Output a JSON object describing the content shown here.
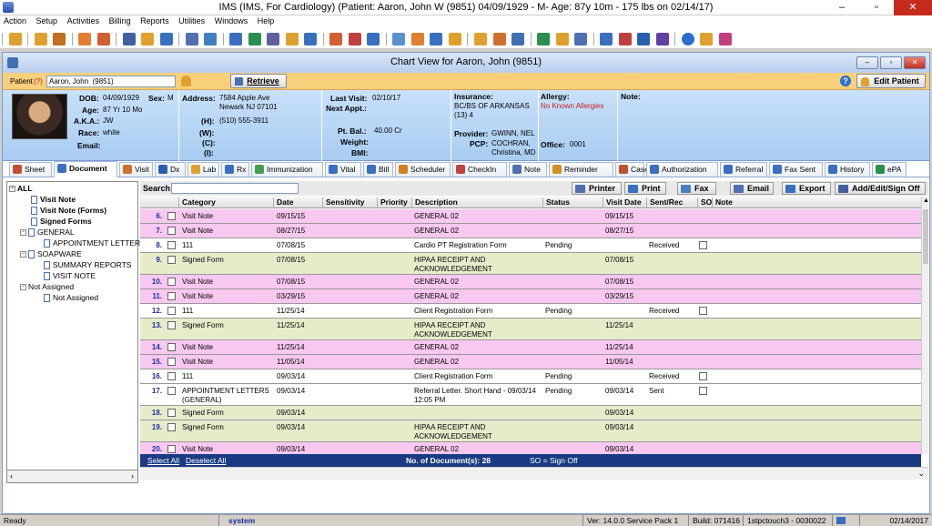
{
  "window": {
    "title": "IMS (IMS, For Cardiology)     (Patient: Aaron, John W (9851) 04/09/1929 - M- Age: 87y 10m  - 175 lbs on 02/14/17)",
    "min": "–",
    "max": "▫",
    "close": "✕"
  },
  "menu": [
    "Action",
    "Setup",
    "Activities",
    "Billing",
    "Reports",
    "Utilities",
    "Windows",
    "Help"
  ],
  "chart_window": {
    "title": "Chart View for Aaron, John  (9851)"
  },
  "patient_bar": {
    "label": "Patient",
    "q": "(?)",
    "value": "Aaron, John  (9851)",
    "retrieve": "Retrieve",
    "edit_patient": "Edit Patient",
    "help": "?"
  },
  "info": {
    "dob_label": "DOB:",
    "dob": "04/09/1929",
    "sex_label": "Sex:",
    "sex": "M",
    "age_label": "Age:",
    "age": "87 Yr 10 Mo",
    "aka_label": "A.K.A.:",
    "aka": "JW",
    "race_label": "Race:",
    "race": "white",
    "email_label": "Email:",
    "address_label": "Address:",
    "address1": "7584 Apple Ave",
    "address2": "Newark  NJ  07101",
    "h_label": "(H):",
    "h": "(510) 555-3911",
    "w_label": "(W):",
    "c_label": "(C):",
    "i_label": "(I):",
    "last_visit_label": "Last Visit:",
    "last_visit": "02/10/17",
    "next_appt_label": "Next Appt.:",
    "pt_bal_label": "Pt. Bal.:",
    "pt_bal": "40.00 Cr",
    "weight_label": "Weight:",
    "bmi_label": "BMI:",
    "insurance_label": "Insurance:",
    "insurance1": "BC/BS OF ARKANSAS",
    "insurance2": "(13)    4",
    "provider_label": "Provider:",
    "provider": "GWINN, NEL",
    "pcp_label": "PCP:",
    "pcp1": "COCHRAN,",
    "pcp2": "Christina, MD",
    "allergy_label": "Allergy:",
    "allergy": "No Known Allergies",
    "office_label": "Office:",
    "office": "0001",
    "note_label": "Note:"
  },
  "tabs": [
    {
      "label": "Sheet",
      "icon": "sheet-icon",
      "color": "#c05030"
    },
    {
      "label": "Document",
      "icon": "document-icon",
      "color": "#3a6fc0"
    },
    {
      "label": "Visit",
      "icon": "visit-icon",
      "color": "#d07030"
    },
    {
      "label": "Dx",
      "icon": "dx-icon",
      "color": "#2a5fb0"
    },
    {
      "label": "Lab",
      "icon": "lab-icon",
      "color": "#e0a030"
    },
    {
      "label": "Rx",
      "icon": "rx-icon",
      "color": "#3a6fc0"
    },
    {
      "label": "Immunization",
      "icon": "immunization-icon",
      "color": "#40a050"
    },
    {
      "label": "Vital",
      "icon": "vital-icon",
      "color": "#3a6fc0"
    },
    {
      "label": "Bill",
      "icon": "bill-icon",
      "color": "#3a6fc0"
    },
    {
      "label": "Scheduler",
      "icon": "scheduler-icon",
      "color": "#d08020"
    },
    {
      "label": "CheckIn",
      "icon": "checkin-icon",
      "color": "#c04040"
    },
    {
      "label": "Note",
      "icon": "note-icon",
      "color": "#5070b0"
    },
    {
      "label": "Reminder",
      "icon": "reminder-icon",
      "color": "#d09020"
    },
    {
      "label": "Case",
      "icon": "case-icon",
      "color": "#c05030"
    },
    {
      "label": "Authorization",
      "icon": "authorization-icon",
      "color": "#3a6fc0"
    },
    {
      "label": "Referral",
      "icon": "referral-icon",
      "color": "#3a6fc0"
    },
    {
      "label": "Fax Sent",
      "icon": "fax-sent-icon",
      "color": "#3a6fc0"
    },
    {
      "label": "History",
      "icon": "history-icon",
      "color": "#3a6fc0"
    },
    {
      "label": "ePA",
      "icon": "epa-icon",
      "color": "#2a8f50"
    }
  ],
  "tree": [
    {
      "label": "ALL",
      "bold": true,
      "level": 0,
      "type": "minus"
    },
    {
      "label": "Visit Note",
      "bold": true,
      "level": 1,
      "type": "doc"
    },
    {
      "label": "Visit Note (Forms)",
      "bold": true,
      "level": 1,
      "type": "doc"
    },
    {
      "label": "Signed Forms",
      "bold": true,
      "level": 1,
      "type": "doc"
    },
    {
      "label": "GENERAL",
      "bold": false,
      "level": 0,
      "type": "minus"
    },
    {
      "label": "APPOINTMENT LETTER",
      "bold": false,
      "level": 1,
      "type": "doc"
    },
    {
      "label": "SOAPWARE",
      "bold": false,
      "level": 0,
      "type": "minus"
    },
    {
      "label": "SUMMARY REPORTS",
      "bold": false,
      "level": 1,
      "type": "doc"
    },
    {
      "label": "VISIT NOTE",
      "bold": false,
      "level": 1,
      "type": "doc"
    },
    {
      "label": "Not Assigned",
      "bold": false,
      "level": 0,
      "type": "minus"
    },
    {
      "label": "Not Assigned",
      "bold": false,
      "level": 1,
      "type": "doc"
    }
  ],
  "search": {
    "label": "Search:"
  },
  "actions": [
    {
      "label": "Printer",
      "icon": "printer-icon"
    },
    {
      "label": "Print",
      "icon": "print-icon"
    },
    {
      "label": "Fax",
      "icon": "fax-icon"
    },
    {
      "label": "Email",
      "icon": "email-icon"
    },
    {
      "label": "Export",
      "icon": "export-icon"
    },
    {
      "label": "Add/Edit/Sign Off",
      "icon": "add-edit-sign-off-icon"
    }
  ],
  "columns": [
    "Category",
    "Date",
    "Sensitivity",
    "Priority",
    "Description",
    "Status",
    "Visit Date",
    "Sent/Rec",
    "SO",
    "Note"
  ],
  "rows": [
    {
      "num": "6.",
      "category": "Visit Note",
      "date": "09/15/15",
      "description": "GENERAL 02",
      "status": "",
      "visit_date": "09/15/15",
      "sent": "",
      "so": false,
      "color": "#f8c8f0"
    },
    {
      "num": "7.",
      "category": "Visit Note",
      "date": "08/27/15",
      "description": "GENERAL 02",
      "status": "",
      "visit_date": "08/27/15",
      "sent": "",
      "so": false,
      "color": "#f8c8f0"
    },
    {
      "num": "8.",
      "category": "111",
      "date": "07/08/15",
      "description": "Cardio PT Registration Form",
      "status": "Pending",
      "visit_date": "",
      "sent": "Received",
      "so": true,
      "color": "#ffffff"
    },
    {
      "num": "9.",
      "category": "Signed Form",
      "date": "07/08/15",
      "description": "HIPAA RECEIPT AND\nACKNOWLEDGEMENT",
      "status": "",
      "visit_date": "07/08/15",
      "sent": "",
      "so": false,
      "color": "#e6ecca"
    },
    {
      "num": "10.",
      "category": "Visit Note",
      "date": "07/08/15",
      "description": "GENERAL 02",
      "status": "",
      "visit_date": "07/08/15",
      "sent": "",
      "so": false,
      "color": "#f8c8f0"
    },
    {
      "num": "11.",
      "category": "Visit Note",
      "date": "03/29/15",
      "description": "GENERAL 02",
      "status": "",
      "visit_date": "03/29/15",
      "sent": "",
      "so": false,
      "color": "#f8c8f0"
    },
    {
      "num": "12.",
      "category": "111",
      "date": "11/25/14",
      "description": "Client Registration Form",
      "status": "Pending",
      "visit_date": "",
      "sent": "Received",
      "so": true,
      "color": "#ffffff"
    },
    {
      "num": "13.",
      "category": "Signed Form",
      "date": "11/25/14",
      "description": "HIPAA RECEIPT AND\nACKNOWLEDGEMENT",
      "status": "",
      "visit_date": "11/25/14",
      "sent": "",
      "so": false,
      "color": "#e6ecca"
    },
    {
      "num": "14.",
      "category": "Visit Note",
      "date": "11/25/14",
      "description": "GENERAL 02",
      "status": "",
      "visit_date": "11/25/14",
      "sent": "",
      "so": false,
      "color": "#f8c8f0"
    },
    {
      "num": "15.",
      "category": "Visit Note",
      "date": "11/05/14",
      "description": "GENERAL 02",
      "status": "",
      "visit_date": "11/05/14",
      "sent": "",
      "so": false,
      "color": "#f8c8f0"
    },
    {
      "num": "16.",
      "category": "111",
      "date": "09/03/14",
      "description": "Client Registration Form",
      "status": "Pending",
      "visit_date": "",
      "sent": "Received",
      "so": true,
      "color": "#ffffff"
    },
    {
      "num": "17.",
      "category": "APPOINTMENT LETTERS\n(GENERAL)",
      "date": "09/03/14",
      "description": "Referral Letter. Short Hand - 09/03/14\n12:05 PM",
      "status": "Pending",
      "visit_date": "09/03/14",
      "sent": "Sent",
      "so": true,
      "color": "#ffffff"
    },
    {
      "num": "18.",
      "category": "Signed Form",
      "date": "09/03/14",
      "description": "",
      "status": "",
      "visit_date": "09/03/14",
      "sent": "",
      "so": false,
      "color": "#e6ecca"
    },
    {
      "num": "19.",
      "category": "Signed Form",
      "date": "09/03/14",
      "description": "HIPAA RECEIPT AND\nACKNOWLEDGEMENT",
      "status": "",
      "visit_date": "09/03/14",
      "sent": "",
      "so": false,
      "color": "#e6ecca"
    },
    {
      "num": "20.",
      "category": "Visit Note",
      "date": "09/03/14",
      "description": "GENERAL 02",
      "status": "",
      "visit_date": "09/03/14",
      "sent": "",
      "so": false,
      "color": "#f8c8f0"
    }
  ],
  "footer": {
    "select_all": "Select All",
    "deselect_all": "Deselect All",
    "count": "No. of Document(s): 28",
    "legend": "SO = Sign Off"
  },
  "status": {
    "ready": "Ready",
    "user": "system",
    "version": "Ver: 14.0.0 Service Pack 1",
    "build": "Build: 071416",
    "station": "1stpctouch3 - 0030022",
    "date": "02/14/2017"
  }
}
